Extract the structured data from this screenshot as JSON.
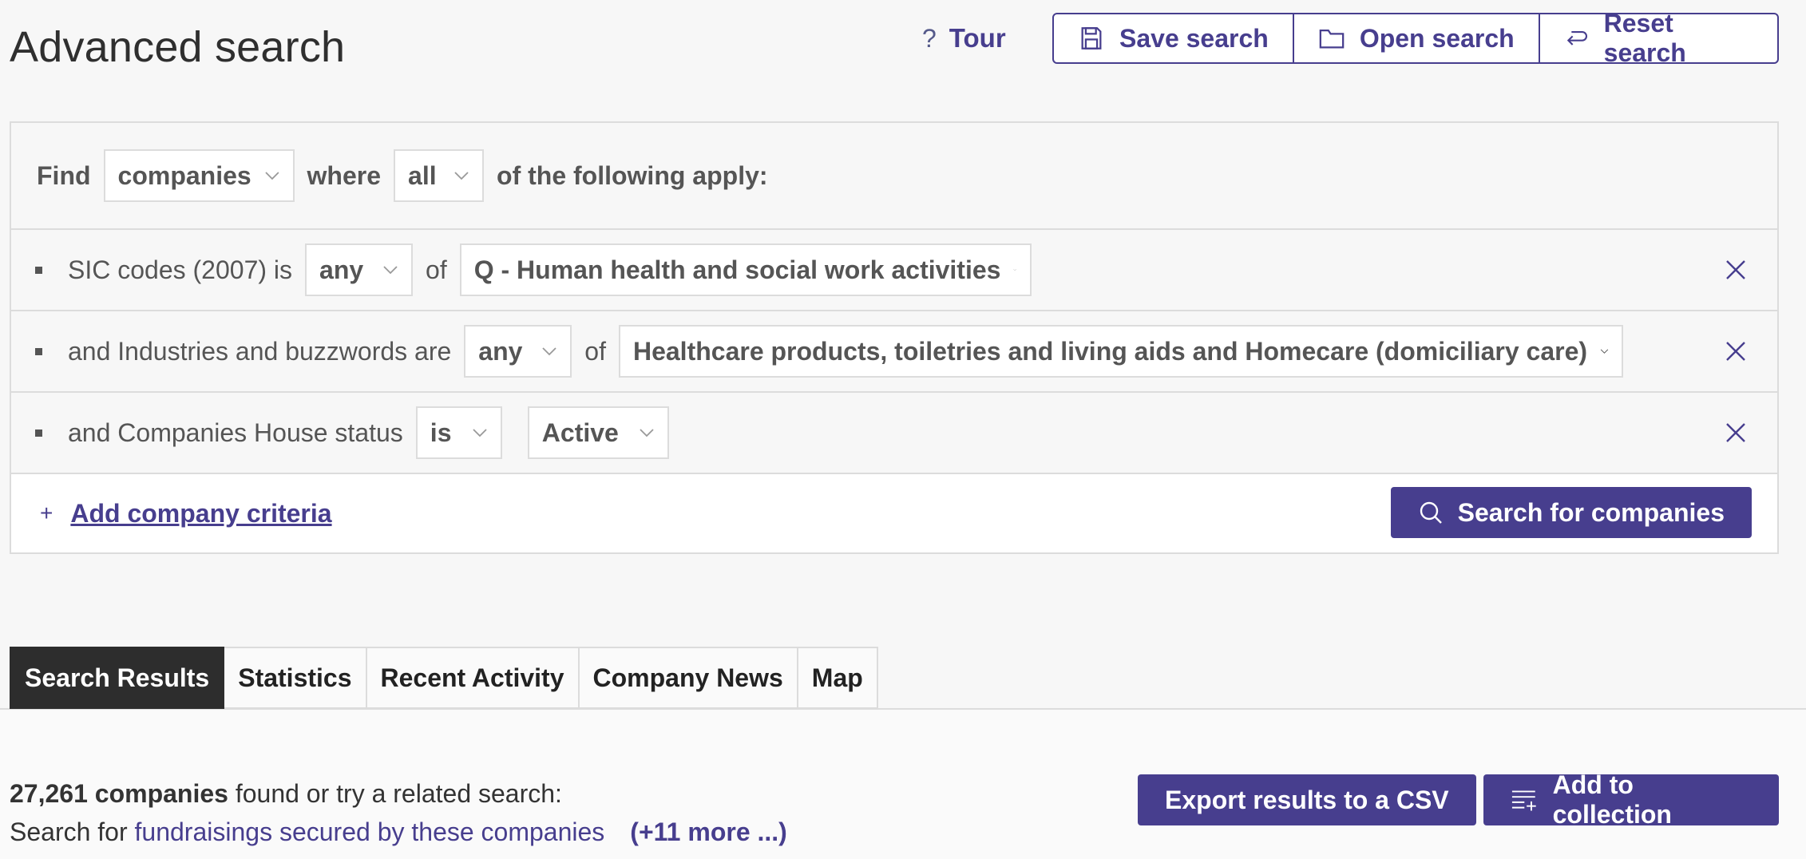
{
  "page": {
    "title": "Advanced search"
  },
  "toolbar": {
    "tour_label": "Tour",
    "save_label": "Save search",
    "open_label": "Open search",
    "reset_label": "Reset search"
  },
  "find": {
    "prefix": "Find",
    "entity": "companies",
    "where": "where",
    "match": "all",
    "suffix": "of the following apply:"
  },
  "criteria": [
    {
      "text": "SIC codes (2007) is",
      "operator": "any",
      "of": "of",
      "value": "Q - Human health and social work activities"
    },
    {
      "text": "and Industries and buzzwords are",
      "operator": "any",
      "of": "of",
      "value": "Healthcare products, toiletries and living aids and Homecare (domiciliary care)"
    },
    {
      "text": "and Companies House status",
      "operator": "is",
      "value": "Active"
    }
  ],
  "actions": {
    "add_plus": "+",
    "add_label": "Add company criteria",
    "search_label": "Search for companies"
  },
  "tabs": [
    {
      "label": "Search Results",
      "active": true
    },
    {
      "label": "Statistics"
    },
    {
      "label": "Recent Activity"
    },
    {
      "label": "Company News"
    },
    {
      "label": "Map"
    }
  ],
  "results": {
    "count": "27,261 companies",
    "count_suffix": " found or try a related search:",
    "related_prefix": "Search for ",
    "related_link": "fundraisings secured by these companies",
    "more_link": "(+11 more ...)",
    "export_label": "Export results to a CSV",
    "collection_label": "Add to collection"
  },
  "colors": {
    "accent": "#473e8e",
    "active_tab": "#2d2d2d"
  }
}
